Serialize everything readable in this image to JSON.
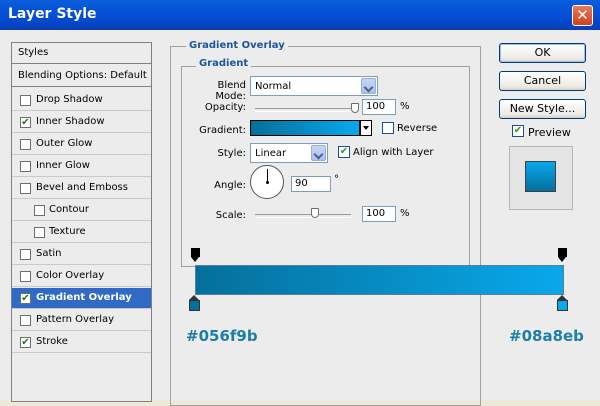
{
  "window": {
    "title": "Layer Style",
    "close_glyph": "✕"
  },
  "styles_panel": {
    "header": "Styles",
    "blending": "Blending Options: Default",
    "items": [
      {
        "label": "Drop Shadow",
        "checked": false
      },
      {
        "label": "Inner Shadow",
        "checked": true
      },
      {
        "label": "Outer Glow",
        "checked": false
      },
      {
        "label": "Inner Glow",
        "checked": false
      },
      {
        "label": "Bevel and Emboss",
        "checked": false
      },
      {
        "label": "Contour",
        "checked": false
      },
      {
        "label": "Texture",
        "checked": false
      },
      {
        "label": "Satin",
        "checked": false
      },
      {
        "label": "Color Overlay",
        "checked": false
      },
      {
        "label": "Gradient Overlay",
        "checked": true,
        "selected": true
      },
      {
        "label": "Pattern Overlay",
        "checked": false
      },
      {
        "label": "Stroke",
        "checked": true
      }
    ]
  },
  "gradient_overlay": {
    "group_title": "Gradient Overlay",
    "subgroup_title": "Gradient",
    "blend_mode_label": "Blend Mode:",
    "blend_mode_value": "Normal",
    "opacity_label": "Opacity:",
    "opacity_value": "100",
    "opacity_fraction": 1.0,
    "percent": "%",
    "gradient_label": "Gradient:",
    "reverse_label": "Reverse",
    "reverse_checked": false,
    "style_label": "Style:",
    "style_value": "Linear",
    "align_label": "Align with Layer",
    "align_checked": true,
    "angle_label": "Angle:",
    "angle_value": "90",
    "degree": "°",
    "scale_label": "Scale:",
    "scale_value": "100"
  },
  "gradient_editor": {
    "color_start": "#056f9b",
    "color_end": "#08a8eb",
    "label_start": "#056f9b",
    "label_end": "#08a8eb"
  },
  "buttons": {
    "ok": "OK",
    "cancel": "Cancel",
    "new_style": "New Style...",
    "preview_label": "Preview",
    "preview_checked": true
  },
  "colors": {
    "title_bar": "#0451d8",
    "selection": "#316ac5",
    "hex_text": "#1c7fa6"
  }
}
